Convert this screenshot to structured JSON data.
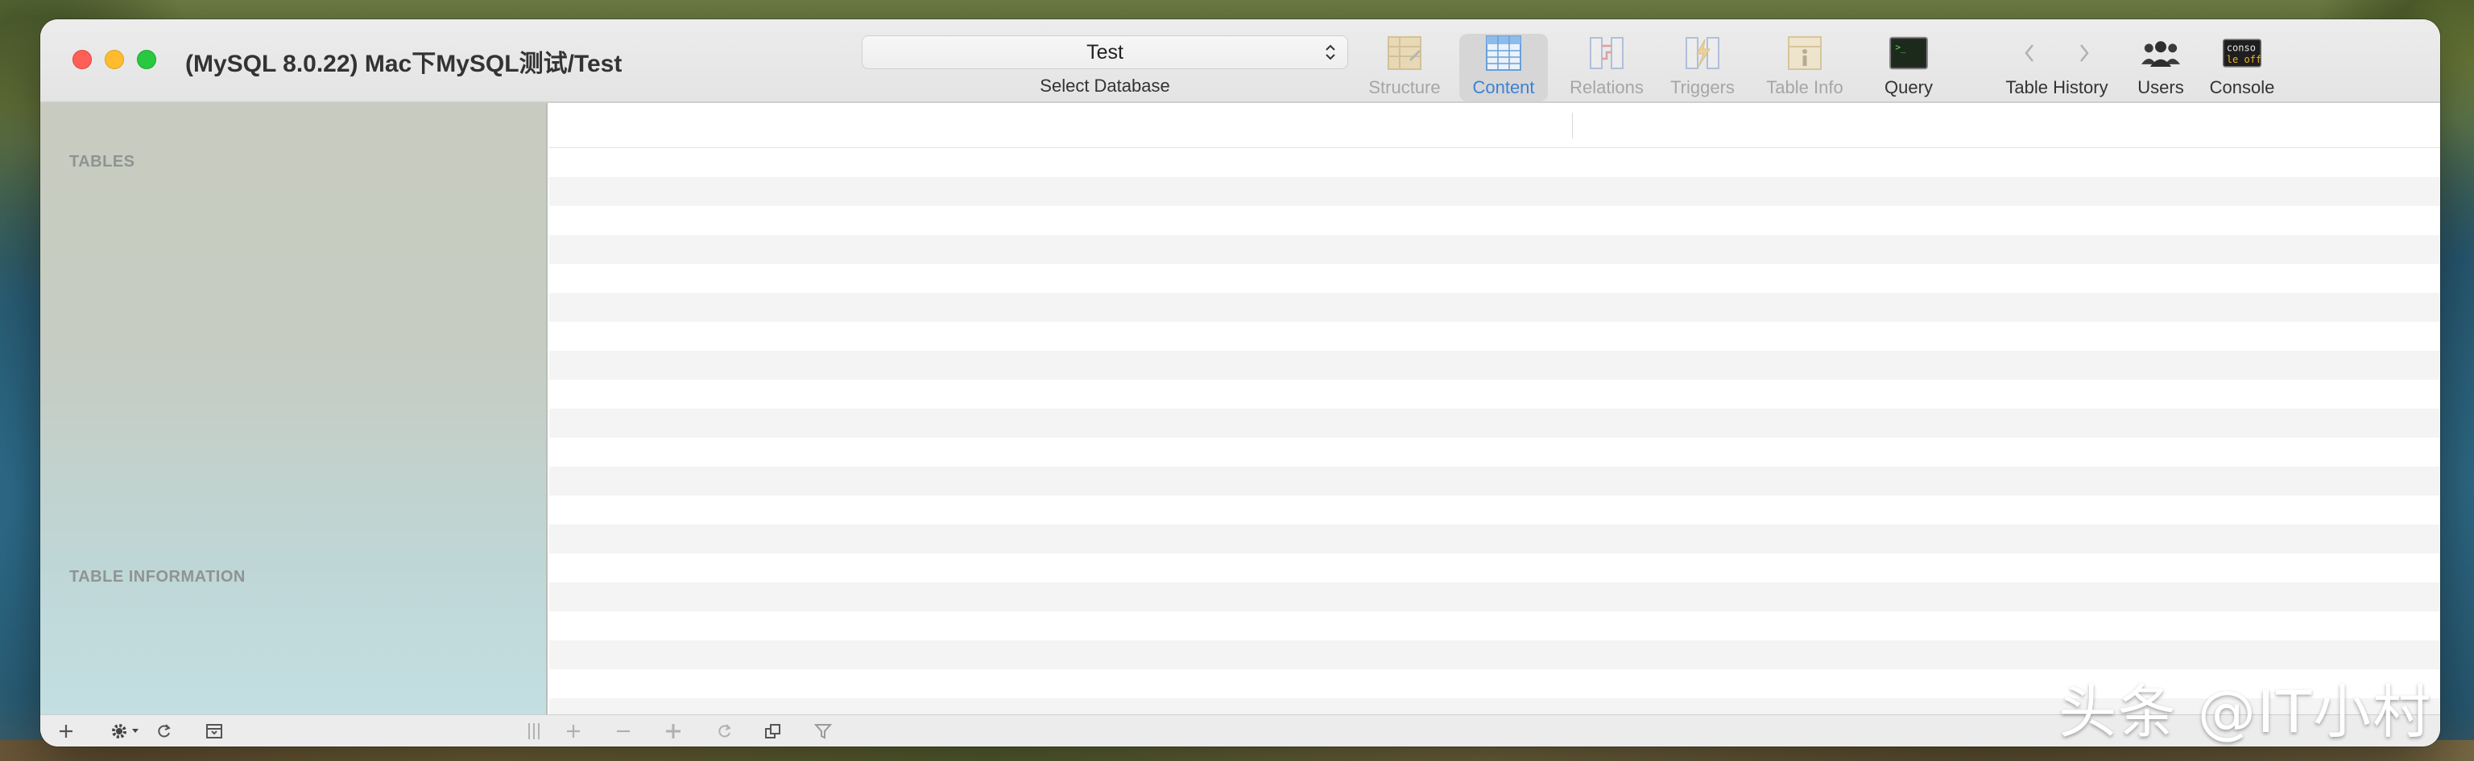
{
  "window": {
    "title": "(MySQL 8.0.22) Mac下MySQL测试/Test"
  },
  "toolbar": {
    "database_select": {
      "value": "Test",
      "label": "Select Database"
    },
    "tools": {
      "structure": "Structure",
      "content": "Content",
      "relations": "Relations",
      "triggers": "Triggers",
      "table_info": "Table Info",
      "query": "Query",
      "table_history": "Table History",
      "users": "Users",
      "console": "Console"
    },
    "console_icon_text": [
      "conso",
      "le off"
    ]
  },
  "sidebar": {
    "tables_header": "TABLES",
    "info_header": "TABLE INFORMATION"
  },
  "colors": {
    "accent": "#3b82d6",
    "traffic_red": "#ff5f57",
    "traffic_yellow": "#febc2e",
    "traffic_green": "#28c840"
  },
  "watermark": "头条 @IT小村"
}
